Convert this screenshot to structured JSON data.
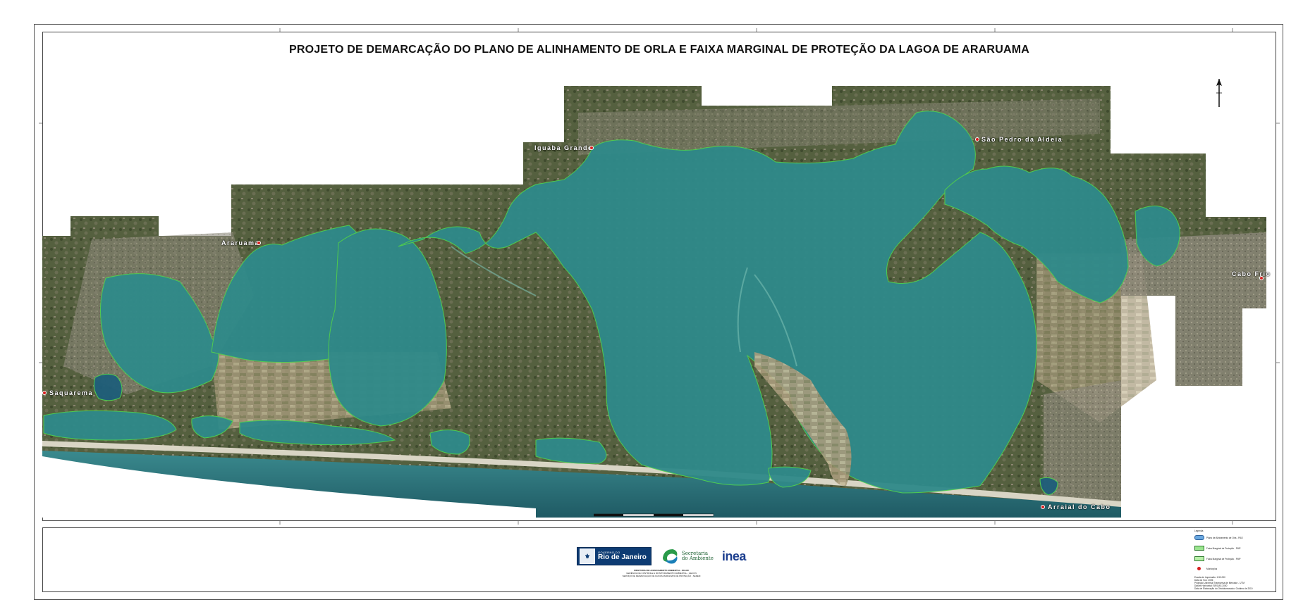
{
  "title": "PROJETO DE DEMARCAÇÃO DO PLANO DE ALINHAMENTO DE ORLA E FAIXA MARGINAL DE PROTEÇÃO DA LAGOA DE ARARUAMA",
  "cities": [
    {
      "name": "Saquarema"
    },
    {
      "name": "Araruama"
    },
    {
      "name": "Iguaba Grande"
    },
    {
      "name": "São Pedro da Aldeia"
    },
    {
      "name": "Cabo Frio"
    },
    {
      "name": "Arraial do Cabo"
    }
  ],
  "colors": {
    "lagoon": "#2f8a8a",
    "lagoon_light": "#4aa3a0",
    "land": "#4f5a3e",
    "urban": "#8b8677",
    "ocean": "#2a6a72",
    "beach": "#d9d5c5",
    "pao_outline": "#4fd14f",
    "city_dot": "#d61f1f"
  },
  "logos": {
    "gov_small": "GOVERNO DO",
    "gov_large": "Rio de Janeiro",
    "secretaria_line1": "Secretaria",
    "secretaria_line2": "do Ambiente",
    "inea": "inea"
  },
  "credits": {
    "line1": "DIRETORIA DE LICENCIAMENTO AMBIENTAL - DILAM",
    "line2": "GERÊNCIA DE CONTROLE E MONITORAMENTO AMBIENTAL - GECON",
    "line3": "SERVIÇO DE DEMARCAÇÃO DE FAIXAS MARGINAIS DE PROTEÇÃO - SEDEM"
  },
  "legend": {
    "title": "Legenda",
    "items": [
      {
        "label": "Plano de Alinhamento de Orla - PAO",
        "swatch": "pao"
      },
      {
        "label": "Faixa Marginal de Proteção - FMP",
        "swatch": "fmp1"
      },
      {
        "label": "Faixa Marginal de Proteção - FMP",
        "swatch": "fmp2"
      },
      {
        "label": "Municípios",
        "swatch": "dot"
      }
    ],
    "meta": [
      "Escala de Impressão: 1:50.000",
      "Data do Voo: 2006",
      "Projeção Universal Transversa de Mercator - UTM",
      "Datum Horizontal: SIRGAS 2000",
      "Data de Elaboração do Ortofotomosaico: Outubro de 2010"
    ]
  }
}
